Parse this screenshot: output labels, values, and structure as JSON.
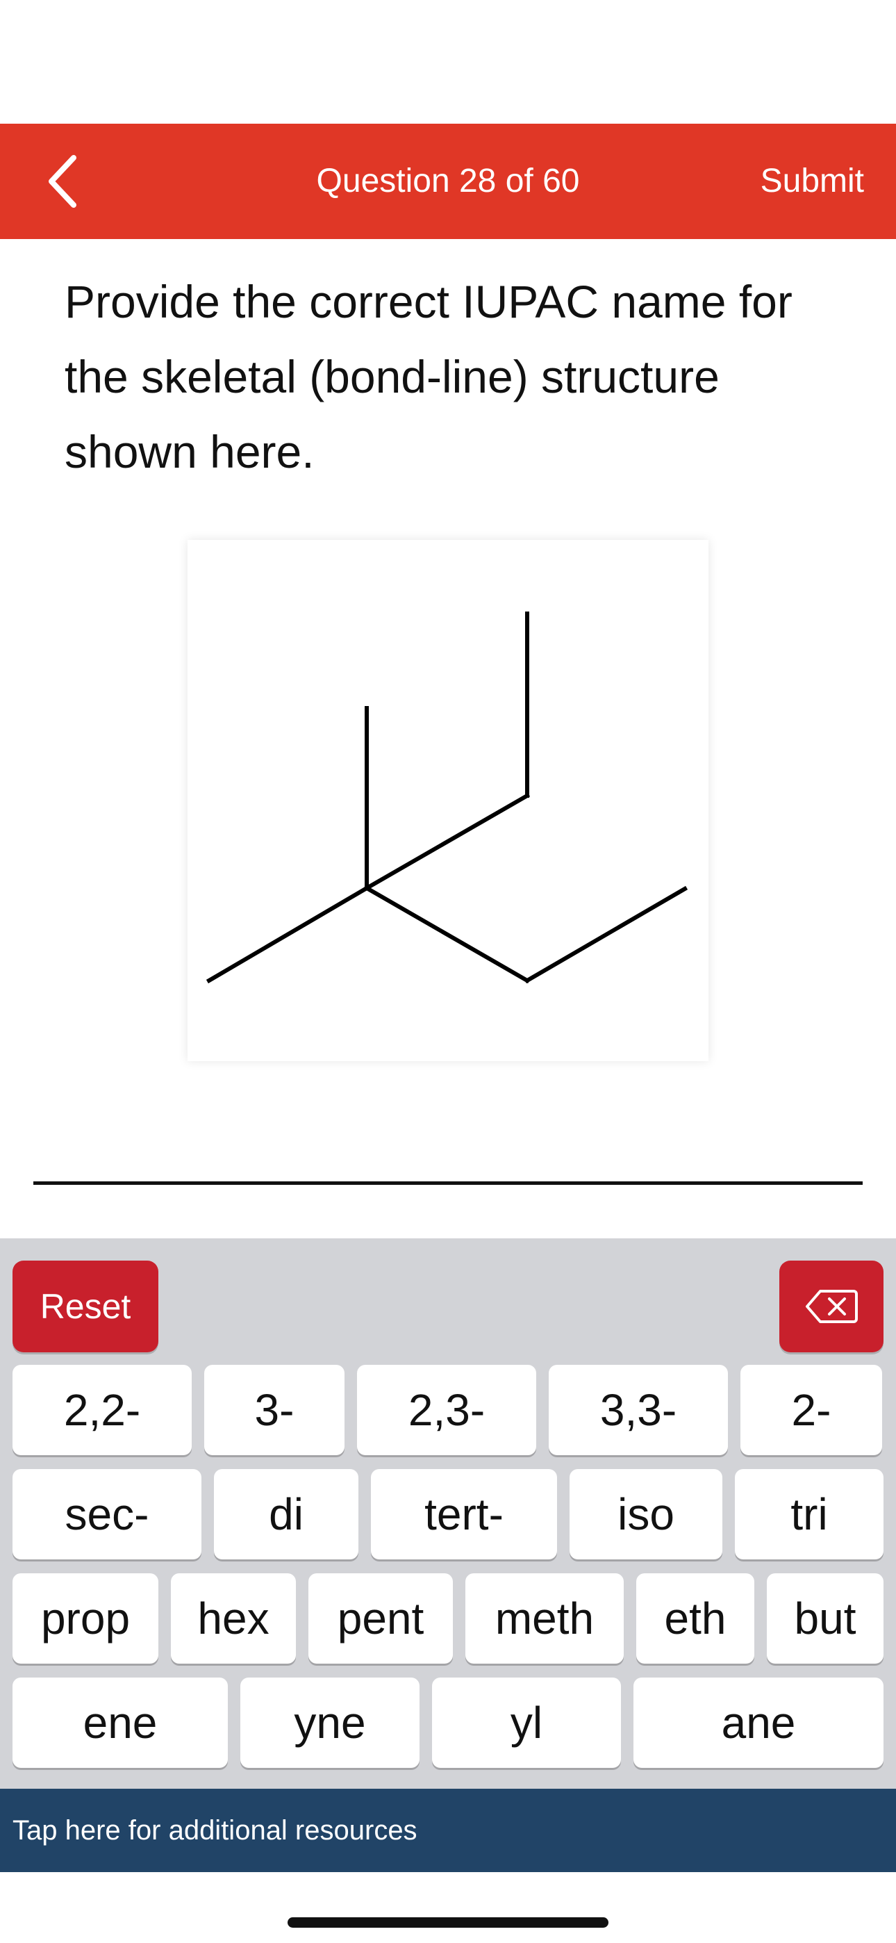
{
  "header": {
    "title": "Question 28 of 60",
    "submit_label": "Submit",
    "color": "#e03726"
  },
  "question": {
    "prompt": "Provide the correct IUPAC name for the skeletal (bond-line) structure shown here."
  },
  "answer": {
    "value": ""
  },
  "keyboard": {
    "reset_label": "Reset",
    "backspace_icon": "backspace-icon",
    "rows": [
      [
        "2,2-",
        "3-",
        "2,3-",
        "3,3-",
        "2-"
      ],
      [
        "sec-",
        "di",
        "tert-",
        "iso",
        "tri"
      ],
      [
        "prop",
        "hex",
        "pent",
        "meth",
        "eth",
        "but"
      ],
      [
        "ene",
        "yne",
        "yl",
        "ane"
      ]
    ],
    "accent_color": "#c8202c"
  },
  "resources": {
    "label": "Tap here for additional resources",
    "color": "#214467"
  }
}
